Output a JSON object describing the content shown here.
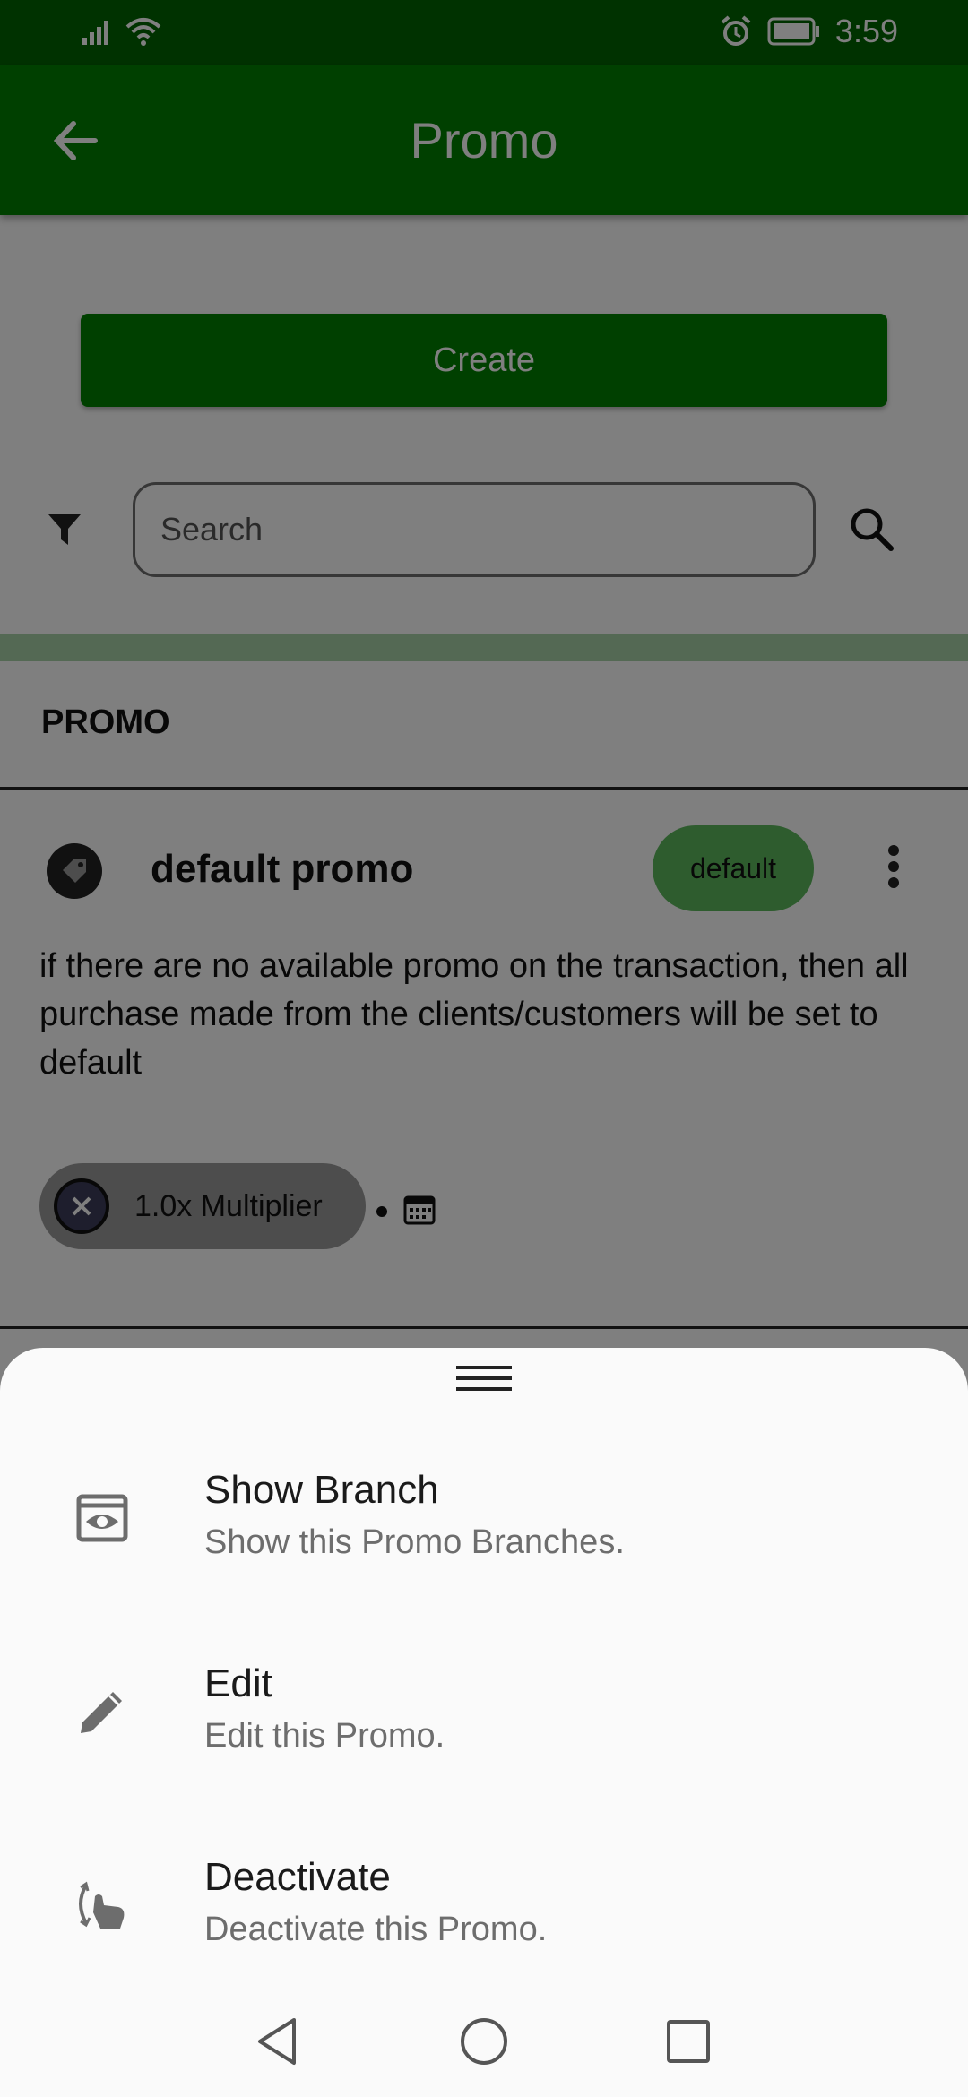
{
  "status_bar": {
    "time": "3:59",
    "icons": [
      "signal-icon",
      "wifi-icon",
      "alarm-icon",
      "battery-icon"
    ]
  },
  "app_bar": {
    "title": "Promo",
    "back_icon": "back-arrow-icon"
  },
  "actions": {
    "create_label": "Create"
  },
  "search": {
    "placeholder": "Search",
    "filter_icon": "filter-icon",
    "search_icon": "search-icon"
  },
  "section": {
    "title": "PROMO"
  },
  "promo": {
    "name": "default promo",
    "badge": "default",
    "description": "if there are no available promo on the transaction, then all purchase made from the clients/customers will be set to default",
    "chip_label": "1.0x Multiplier"
  },
  "bottom_sheet": {
    "items": [
      {
        "title": "Show Branch",
        "subtitle": "Show this Promo Branches.",
        "icon": "eye-icon"
      },
      {
        "title": "Edit",
        "subtitle": "Edit this Promo.",
        "icon": "pencil-icon"
      },
      {
        "title": "Deactivate",
        "subtitle": "Deactivate this Promo.",
        "icon": "swipe-hand-icon"
      }
    ]
  },
  "nav_bar": {
    "buttons": [
      "back-triangle-icon",
      "home-circle-icon",
      "recents-square-icon"
    ]
  },
  "colors": {
    "primary": "#008000",
    "primary_dark": "#006400",
    "badge": "#5cb85c",
    "sheet_bg": "#fafafa"
  }
}
